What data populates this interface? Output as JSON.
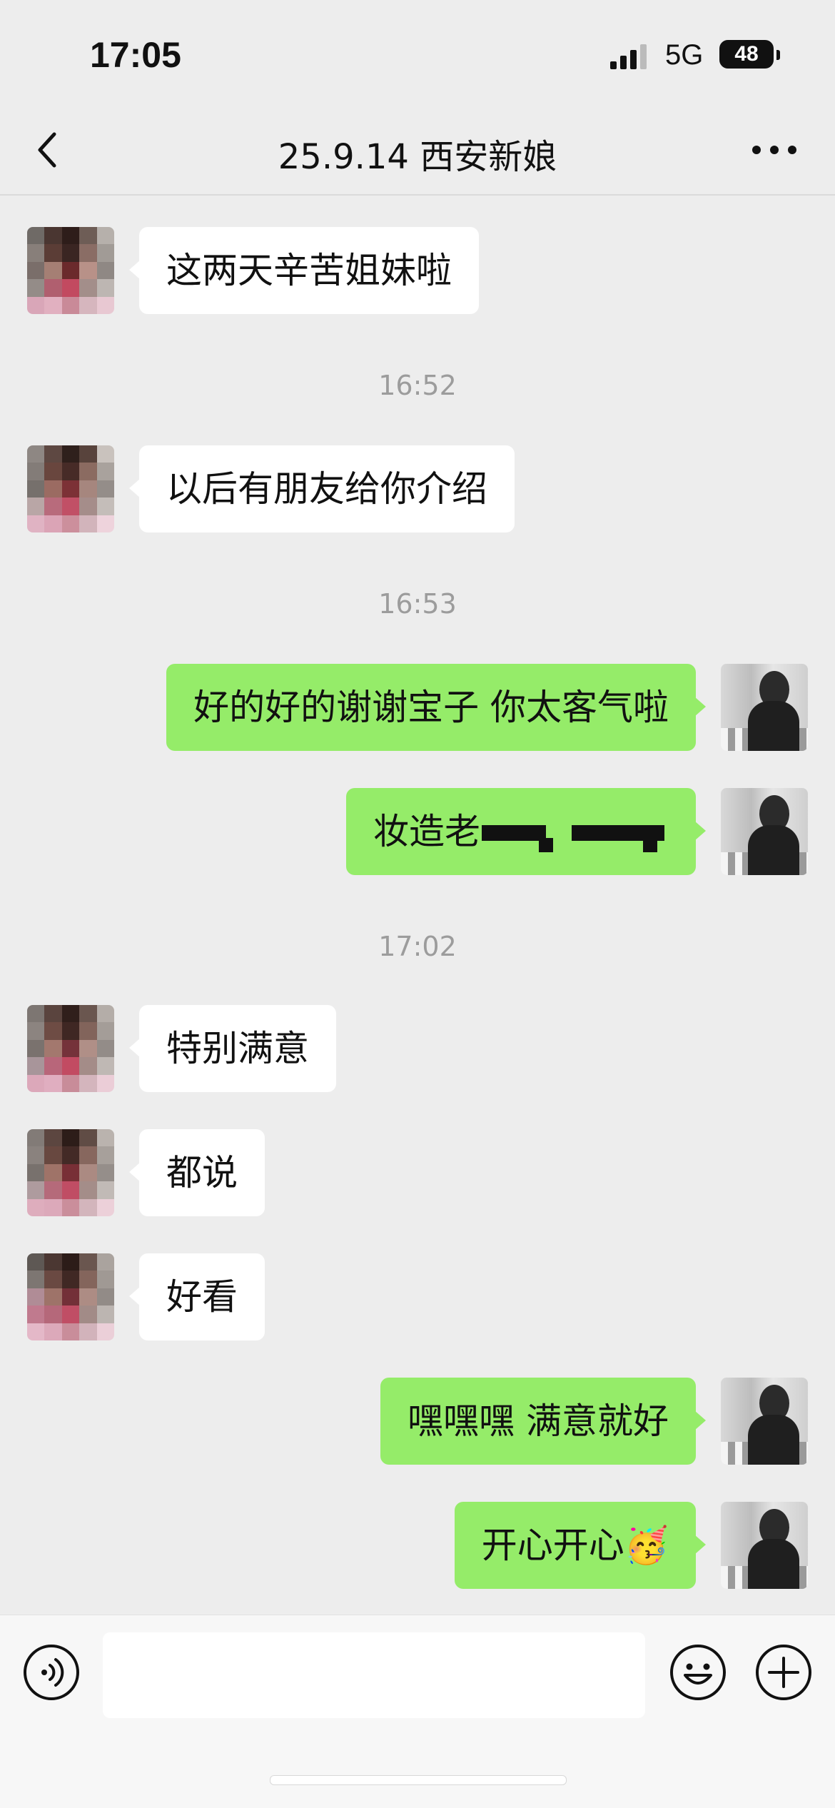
{
  "status_bar": {
    "time": "17:05",
    "network": "5G",
    "battery": "48"
  },
  "nav": {
    "title": "25.9.14 西安新娘",
    "back_icon": "chevron-left-icon",
    "more_icon": "more-dots-icon"
  },
  "messages": [
    {
      "type": "in",
      "text": "这两天辛苦姐妹啦"
    },
    {
      "type": "time",
      "text": "16:52"
    },
    {
      "type": "in",
      "text": "以后有朋友给你介绍"
    },
    {
      "type": "time",
      "text": "16:53"
    },
    {
      "type": "out",
      "text": "好的好的谢谢宝子 你太客气啦"
    },
    {
      "type": "out",
      "text": "妆造老"
    },
    {
      "type": "time",
      "text": "17:02"
    },
    {
      "type": "in",
      "text": "特别满意"
    },
    {
      "type": "in",
      "text": "都说"
    },
    {
      "type": "in",
      "text": "好看"
    },
    {
      "type": "out",
      "text": "嘿嘿嘿 满意就好"
    },
    {
      "type": "out",
      "text": "开心开心🥳"
    }
  ],
  "input_bar": {
    "placeholder": "",
    "voice_icon": "voice-icon",
    "emoji_icon": "emoji-icon",
    "plus_icon": "plus-icon"
  },
  "colors": {
    "background": "#ededed",
    "incoming_bubble": "#ffffff",
    "outgoing_bubble": "#95ec69",
    "timestamp": "#9c9c9c"
  }
}
